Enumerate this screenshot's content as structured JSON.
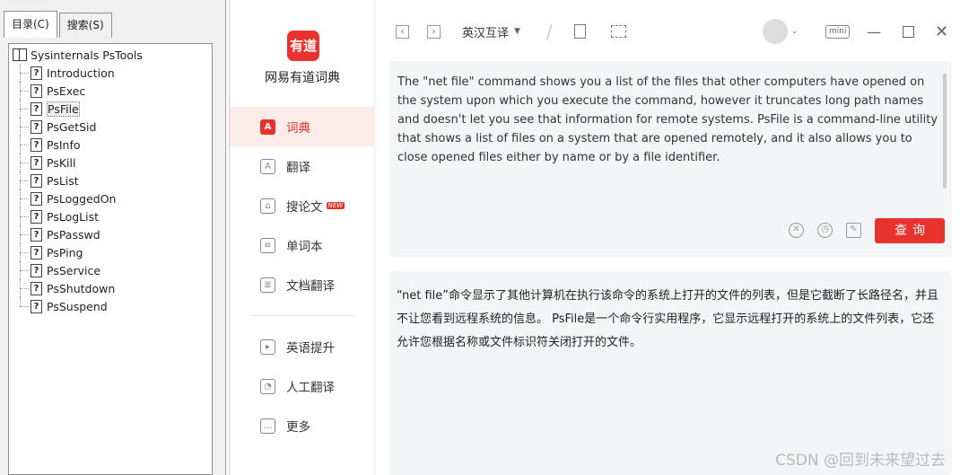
{
  "help_window": {
    "tabs": [
      "目录(C)",
      "搜索(S)"
    ],
    "tree_root": "Sysinternals PsTools",
    "tree_items": [
      "Introduction",
      "PsExec",
      "PsFile",
      "PsGetSid",
      "PsInfo",
      "PsKill",
      "PsList",
      "PsLoggedOn",
      "PsLogList",
      "PsPasswd",
      "PsPing",
      "PsService",
      "PsShutdown",
      "PsSuspend"
    ],
    "selected_item": "PsFile"
  },
  "youdao": {
    "logo_text": "有道",
    "app_name": "网易有道词典",
    "nav": [
      {
        "label": "词典",
        "icon": "dictionary-icon",
        "active": true
      },
      {
        "label": "翻译",
        "icon": "translate-icon"
      },
      {
        "label": "搜论文",
        "icon": "graduation-cap-icon",
        "badge": "NEW"
      },
      {
        "label": "单词本",
        "icon": "wordbook-icon"
      },
      {
        "label": "文档翻译",
        "icon": "document-icon"
      },
      {
        "label": "英语提升",
        "icon": "play-icon"
      },
      {
        "label": "人工翻译",
        "icon": "headset-icon"
      },
      {
        "label": "更多",
        "icon": "more-icon"
      }
    ],
    "toolbar": {
      "lang_select": "英汉互译",
      "mini_label": "mini"
    },
    "input_text": "The \"net file\" command shows you a list of the files that other computers have opened on the system upon which you execute the command, however it truncates long path names and doesn't let you see that information for remote systems. PsFile is a command-line utility that shows a list of files on a system that are opened remotely, and it also allows you to close opened files either by name or by a file identifier.",
    "query_button": "查询",
    "output_text": "“net file”命令显示了其他计算机在执行该命令的系统上打开的文件的列表，但是它截断了长路径名，并且不让您看到远程系统的信息。 PsFile是一个命令行实用程序，它显示远程打开的系统上的文件列表，它还允许您根据名称或文件标识符关闭打开的文件。"
  },
  "watermark": "CSDN @回到未来望过去"
}
